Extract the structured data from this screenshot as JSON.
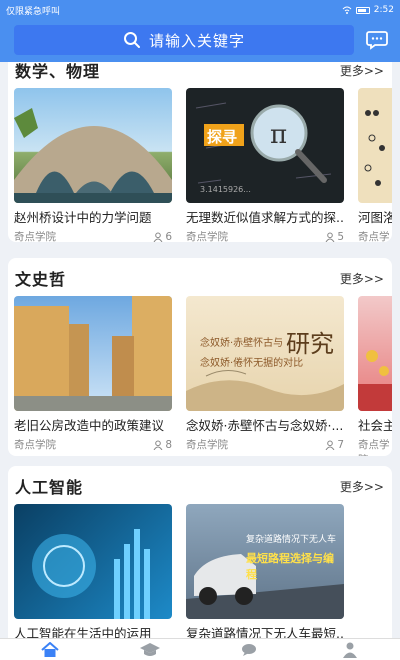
{
  "status_bar": {
    "left_text": "仅限紧急呼叫",
    "time": "2:52"
  },
  "search": {
    "placeholder": "请输入关键字",
    "icon": "search-icon"
  },
  "header": {
    "message_icon": "chat-bubble-icon"
  },
  "sections": [
    {
      "title": "数学、物理",
      "more": "更多>>",
      "items": [
        {
          "title": "赵州桥设计中的力学问题",
          "source": "奇点学院",
          "count": "6"
        },
        {
          "title": "无理数近似值求解方式的探...",
          "source": "奇点学院",
          "count": "5",
          "image_text": "探寻"
        },
        {
          "title": "河图洛",
          "source": "奇点学院"
        }
      ]
    },
    {
      "title": "文史哲",
      "more": "更多>>",
      "items": [
        {
          "title": "老旧公房改造中的政策建议",
          "source": "奇点学院",
          "count": "8"
        },
        {
          "title": "念奴娇·赤壁怀古与念奴娇·...",
          "source": "奇点学院",
          "count": "7",
          "image_text": "研究",
          "image_line1": "念奴娇·赤壁怀古与",
          "image_line2": "念奴娇·倦怀无据的对比"
        },
        {
          "title": "社会主",
          "source": "奇点学院"
        }
      ]
    },
    {
      "title": "人工智能",
      "more": "更多>>",
      "items": [
        {
          "title": "人工智能在生活中的运用"
        },
        {
          "title": "复杂道路情况下无人车最短...",
          "image_line1": "复杂道路情况下无人车",
          "image_line2": "最短路程选择与编程"
        }
      ]
    }
  ],
  "bottom_nav": [
    {
      "icon": "home-icon",
      "color": "#3b82f6"
    },
    {
      "icon": "graduation-cap-icon",
      "color": "#9aa0a6"
    },
    {
      "icon": "chat-icon",
      "color": "#9aa0a6"
    },
    {
      "icon": "user-icon",
      "color": "#9aa0a6"
    }
  ]
}
